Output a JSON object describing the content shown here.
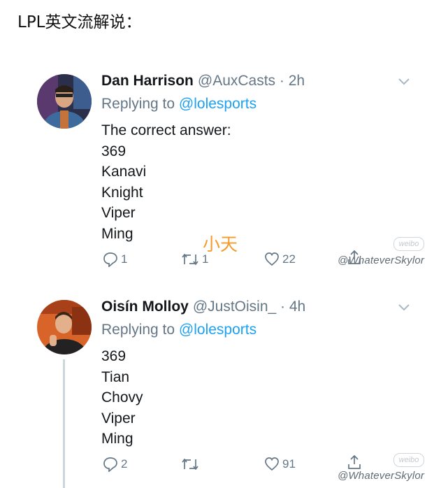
{
  "page_header": "LPL英文流解说：",
  "overlay_text": "小天",
  "tweets": [
    {
      "display_name": "Dan Harrison",
      "handle_time": "@AuxCasts · 2h",
      "replying_prefix": "Replying to",
      "replying_to": "@lolesports",
      "body": [
        "The correct answer:",
        "369",
        "Kanavi",
        "Knight",
        "Viper",
        "Ming"
      ],
      "reply_count": "1",
      "retweet_count": "1",
      "like_count": "22",
      "watermark": "@WhateverSkylor",
      "watermark_logo": "weibo"
    },
    {
      "display_name": "Oisín Molloy",
      "handle_time": "@JustOisin_ · 4h",
      "replying_prefix": "Replying to",
      "replying_to": "@lolesports",
      "body": [
        "369",
        "Tian",
        "Chovy",
        "Viper",
        "Ming"
      ],
      "reply_count": "2",
      "retweet_count": "",
      "like_count": "91",
      "watermark": "@WhateverSkylor",
      "watermark_logo": "weibo"
    }
  ],
  "icons": {
    "reply": "reply-icon",
    "retweet": "retweet-icon",
    "like": "heart-icon",
    "share": "share-icon",
    "more": "chevron-down-icon"
  },
  "colors": {
    "link": "#1da1f2",
    "secondary": "#657786",
    "overlay": "#f59a2c"
  }
}
